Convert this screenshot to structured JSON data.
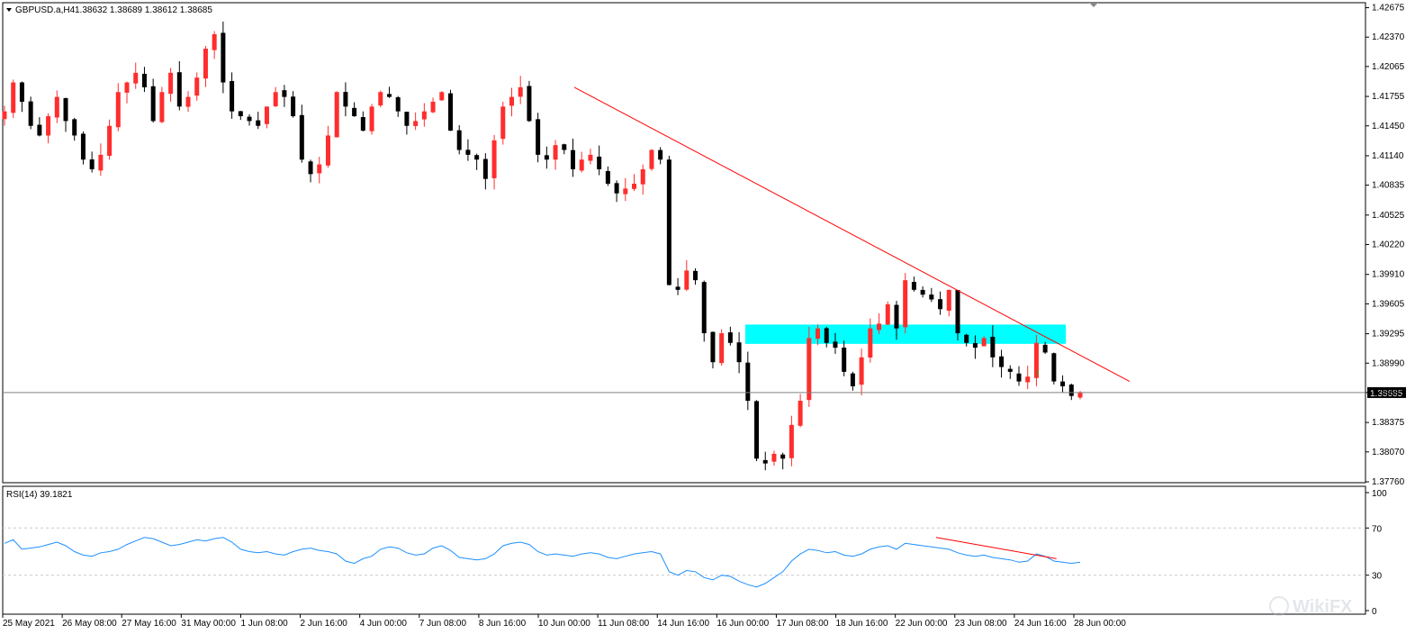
{
  "header": {
    "symbol": "GBPUSD.a,H4",
    "ohlc": "1.38632 1.38689 1.38612 1.38685"
  },
  "rsi_header": "RSI(14) 39.1821",
  "watermark": "WikiFX",
  "current_price_label": "1.38685",
  "colors": {
    "bull": "#ff2d2d",
    "bear": "#000000",
    "trendline": "#ff0000",
    "zone": "#00ffff",
    "rsi": "#1e90ff",
    "grid": "#c8c8c8"
  },
  "chart_data": [
    {
      "type": "candlestick",
      "title": "GBPUSD.a,H4",
      "ylim": [
        1.3776,
        1.4268
      ],
      "y_ticks": [
        "1.42675",
        "1.42370",
        "1.42065",
        "1.41755",
        "1.41450",
        "1.41140",
        "1.40835",
        "1.40525",
        "1.40220",
        "1.39910",
        "1.39605",
        "1.39295",
        "1.38990",
        "1.38685",
        "1.38375",
        "1.38070",
        "1.37760"
      ],
      "x_ticks": [
        "25 May 2021",
        "26 May 08:00",
        "27 May 16:00",
        "31 May 00:00",
        "1 Jun 08:00",
        "2 Jun 16:00",
        "4 Jun 00:00",
        "7 Jun 08:00",
        "8 Jun 16:00",
        "10 Jun 00:00",
        "11 Jun 08:00",
        "14 Jun 16:00",
        "16 Jun 00:00",
        "17 Jun 08:00",
        "18 Jun 16:00",
        "22 Jun 00:00",
        "23 Jun 08:00",
        "24 Jun 16:00",
        "28 Jun 00:00"
      ],
      "current_price": 1.38685,
      "close_path": [
        1.416,
        1.419,
        1.417,
        1.4145,
        1.4135,
        1.4155,
        1.4175,
        1.415,
        1.4135,
        1.411,
        1.41,
        1.4115,
        1.4145,
        1.418,
        1.419,
        1.42,
        1.4185,
        1.415,
        1.418,
        1.42,
        1.4165,
        1.4175,
        1.4195,
        1.4225,
        1.424,
        1.419,
        1.416,
        1.4155,
        1.415,
        1.4145,
        1.4165,
        1.418,
        1.4175,
        1.4155,
        1.411,
        1.4095,
        1.4105,
        1.4135,
        1.418,
        1.4165,
        1.4155,
        1.414,
        1.4165,
        1.418,
        1.4175,
        1.416,
        1.4145,
        1.415,
        1.416,
        1.417,
        1.418,
        1.414,
        1.412,
        1.4115,
        1.411,
        1.409,
        1.413,
        1.4165,
        1.4175,
        1.4185,
        1.415,
        1.4115,
        1.411,
        1.4125,
        1.412,
        1.41,
        1.411,
        1.4115,
        1.41,
        1.4085,
        1.4075,
        1.408,
        1.4085,
        1.41,
        1.412,
        1.411,
        1.398,
        1.3975,
        1.3995,
        1.3985,
        1.393,
        1.39,
        1.393,
        1.392,
        1.39,
        1.386,
        1.38,
        1.3795,
        1.3805,
        1.38,
        1.3835,
        1.386,
        1.3925,
        1.3935,
        1.392,
        1.3915,
        1.389,
        1.3875,
        1.3905,
        1.3935,
        1.394,
        1.396,
        1.3935,
        1.3985,
        1.3975,
        1.397,
        1.3965,
        1.3955,
        1.3975,
        1.393,
        1.392,
        1.3915,
        1.3925,
        1.3905,
        1.3895,
        1.389,
        1.388,
        1.3885,
        1.392,
        1.391,
        1.388,
        1.3875,
        1.3865,
        1.38685
      ]
    },
    {
      "type": "line",
      "title": "RSI(14) 39.1821",
      "ylim": [
        0,
        100
      ],
      "y_ticks": [
        "100",
        "70",
        "30",
        "0"
      ],
      "levels": [
        70,
        30
      ],
      "values": [
        57,
        60,
        52,
        53,
        54,
        56,
        58,
        55,
        50,
        47,
        46,
        49,
        50,
        52,
        56,
        59,
        62,
        61,
        58,
        55,
        56,
        58,
        60,
        59,
        61,
        62,
        58,
        52,
        50,
        49,
        50,
        48,
        47,
        50,
        52,
        53,
        51,
        50,
        48,
        42,
        40,
        44,
        46,
        52,
        54,
        53,
        49,
        47,
        48,
        53,
        55,
        51,
        45,
        44,
        43,
        44,
        48,
        55,
        57,
        58,
        56,
        50,
        47,
        48,
        47,
        46,
        48,
        49,
        48,
        45,
        44,
        46,
        48,
        49,
        50,
        48,
        33,
        30,
        34,
        33,
        28,
        26,
        30,
        29,
        25,
        22,
        20,
        23,
        28,
        33,
        42,
        48,
        52,
        51,
        49,
        50,
        47,
        46,
        48,
        52,
        54,
        55,
        52,
        57,
        56,
        55,
        54,
        53,
        52,
        49,
        47,
        46,
        47,
        45,
        44,
        43,
        41,
        42,
        48,
        46,
        42,
        41,
        40,
        41
      ],
      "divergence_line": {
        "from": {
          "x": 0.866,
          "y": 62
        },
        "to": {
          "x": 0.978,
          "y": 44
        }
      }
    }
  ]
}
